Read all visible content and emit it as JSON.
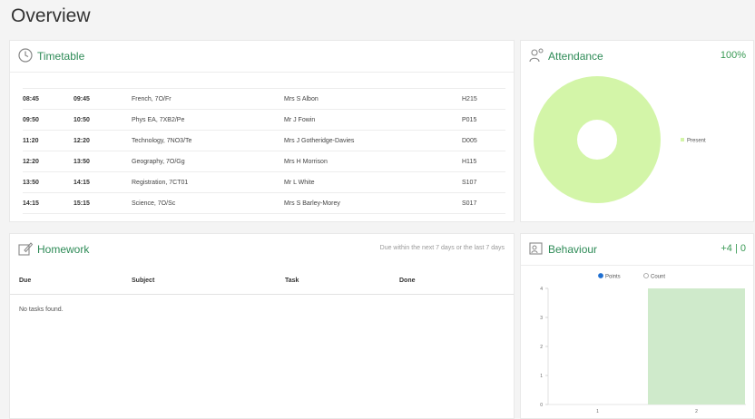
{
  "page": {
    "title": "Overview"
  },
  "timetable": {
    "title": "Timetable",
    "rows": [
      {
        "start": "08:45",
        "end": "09:45",
        "subject": "French, 7O/Fr",
        "teacher": "Mrs S Albon",
        "room": "H215"
      },
      {
        "start": "09:50",
        "end": "10:50",
        "subject": "Phys EA, 7XB2/Pe",
        "teacher": "Mr J Fowin",
        "room": "P015"
      },
      {
        "start": "11:20",
        "end": "12:20",
        "subject": "Technology, 7NO3/Te",
        "teacher": "Mrs J Gotheridge-Davies",
        "room": "D005"
      },
      {
        "start": "12:20",
        "end": "13:50",
        "subject": "Geography, 7O/Gg",
        "teacher": "Mrs H Morrison",
        "room": "H115"
      },
      {
        "start": "13:50",
        "end": "14:15",
        "subject": "Registration, 7CT01",
        "teacher": "Mr L White",
        "room": "S107"
      },
      {
        "start": "14:15",
        "end": "15:15",
        "subject": "Science, 7O/Sc",
        "teacher": "Mrs S Barley-Morey",
        "room": "S017"
      }
    ]
  },
  "attendance": {
    "title": "Attendance",
    "percent": "100%",
    "legend": [
      {
        "label": "Present",
        "color": "#d3f5a8",
        "value": 100
      }
    ]
  },
  "homework": {
    "title": "Homework",
    "note": "Due within the next 7 days or the last 7 days",
    "columns": [
      "Due",
      "Subject",
      "Task",
      "Done"
    ],
    "empty_text": "No tasks found."
  },
  "behaviour": {
    "title": "Behaviour",
    "summary": "+4 | 0",
    "toggle": {
      "options": [
        "Points",
        "Count"
      ],
      "selected": "Points"
    },
    "chart_data": {
      "type": "bar",
      "categories": [
        "1",
        "2"
      ],
      "values": [
        0,
        4
      ],
      "ylim": [
        0,
        4
      ],
      "yticks": [
        "0",
        "1",
        "2",
        "3",
        "4"
      ],
      "bar_color": "#cfeacb"
    }
  },
  "colors": {
    "accent": "#2e8b57",
    "present": "#d3f5a8",
    "toggle_selected": "#1f6fd1"
  }
}
